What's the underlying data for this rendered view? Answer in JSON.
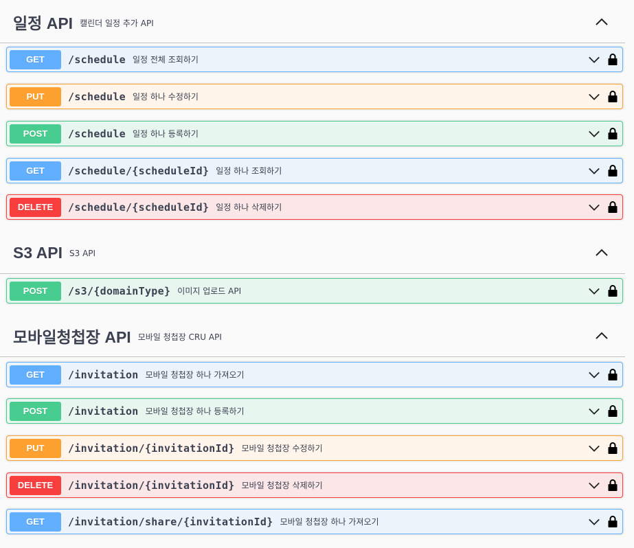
{
  "sections": [
    {
      "title": "일정 API",
      "description": "캘린더 일정 추가 API",
      "operations": [
        {
          "method": "GET",
          "path": "/schedule",
          "summary": "일정 전체 조회하기"
        },
        {
          "method": "PUT",
          "path": "/schedule",
          "summary": "일정 하나 수정하기"
        },
        {
          "method": "POST",
          "path": "/schedule",
          "summary": "일정 하나 등록하기"
        },
        {
          "method": "GET",
          "path": "/schedule/{scheduleId}",
          "summary": "일정 하나 조회하기"
        },
        {
          "method": "DELETE",
          "path": "/schedule/{scheduleId}",
          "summary": "일정 하나 삭제하기"
        }
      ]
    },
    {
      "title": "S3 API",
      "description": "S3 API",
      "operations": [
        {
          "method": "POST",
          "path": "/s3/{domainType}",
          "summary": "이미지 업로드 API"
        }
      ]
    },
    {
      "title": "모바일청첩장 API",
      "description": "모바일 청첩장 CRU API",
      "operations": [
        {
          "method": "GET",
          "path": "/invitation",
          "summary": "모바일 청첩장 하나 가져오기"
        },
        {
          "method": "POST",
          "path": "/invitation",
          "summary": "모바일 청첩장 하나 등록하기"
        },
        {
          "method": "PUT",
          "path": "/invitation/{invitationId}",
          "summary": "모바일 청첩장 수정하기"
        },
        {
          "method": "DELETE",
          "path": "/invitation/{invitationId}",
          "summary": "모바일 청첩장 삭제하기"
        },
        {
          "method": "GET",
          "path": "/invitation/share/{invitationId}",
          "summary": "모바일 청첩장 하나 가져오기"
        }
      ]
    }
  ],
  "colors": {
    "get": "#61affe",
    "put": "#fca130",
    "post": "#49cc90",
    "delete": "#f93e3e"
  },
  "icons": {
    "collapse": "chevron-up-icon",
    "expand": "chevron-down-icon",
    "auth": "lock-icon"
  }
}
